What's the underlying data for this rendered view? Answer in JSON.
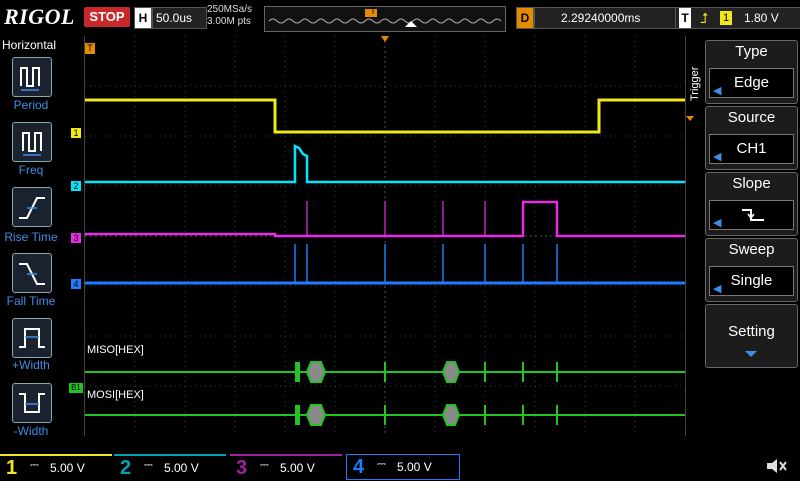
{
  "header": {
    "brand": "RIGOL",
    "run_state": "STOP",
    "timebase_label": "H",
    "timebase_value": "50.0us",
    "sample_rate": "250MSa/s",
    "memory_depth": "3.00M pts",
    "memory_marker": "T",
    "delay_label": "D",
    "delay_value": "2.29240000ms",
    "trigger_label": "T",
    "trigger_channel": "1",
    "trigger_level": "1.80 V"
  },
  "left_menu": {
    "title": "Horizontal",
    "items": [
      {
        "label": "Period",
        "icon": "period-icon"
      },
      {
        "label": "Freq",
        "icon": "freq-icon"
      },
      {
        "label": "Rise Time",
        "icon": "rise-time-icon"
      },
      {
        "label": "Fall Time",
        "icon": "fall-time-icon"
      },
      {
        "label": "+Width",
        "icon": "pos-width-icon"
      },
      {
        "label": "-Width",
        "icon": "neg-width-icon"
      }
    ]
  },
  "screen": {
    "trigger_marker": "T",
    "ch_markers": [
      "1",
      "2",
      "3",
      "4"
    ],
    "bus_marker": "B1",
    "decode_labels": [
      "MISO[HEX]",
      "MOSI[HEX]"
    ]
  },
  "right_menu": {
    "side_label": "Trigger",
    "items": [
      {
        "title": "Type",
        "value": "Edge"
      },
      {
        "title": "Source",
        "value": "CH1"
      },
      {
        "title": "Slope",
        "value": ""
      },
      {
        "title": "Sweep",
        "value": "Single"
      },
      {
        "title": "Setting",
        "value": ""
      }
    ]
  },
  "channels": [
    {
      "num": "1",
      "scale": "5.00 V",
      "color": "#f0e81a"
    },
    {
      "num": "2",
      "scale": "5.00 V",
      "color": "#00e4ff"
    },
    {
      "num": "3",
      "scale": "5.00 V",
      "color": "#e82be8"
    },
    {
      "num": "4",
      "scale": "5.00 V",
      "color": "#1e7bff"
    }
  ],
  "colors": {
    "ch1": "#f0e81a",
    "ch2": "#00e4ff",
    "ch3": "#e82be8",
    "ch4": "#1e7bff",
    "decode": "#22c322",
    "accent": "#e68b00",
    "stop": "#c8282a"
  }
}
